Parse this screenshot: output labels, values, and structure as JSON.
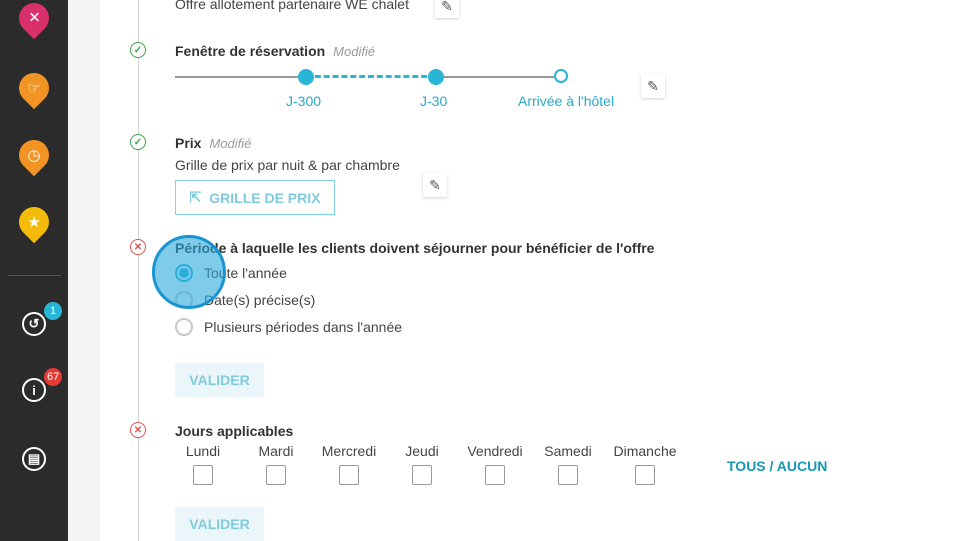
{
  "sidebar": {
    "icons": [
      "cutlery-icon",
      "hand-icon",
      "clock-icon",
      "star-icon"
    ],
    "colors": {
      "pink": "#d9306b",
      "orange": "#f29424",
      "yellow": "#f5bb0b"
    },
    "history_badge": "1",
    "info_badge": "67"
  },
  "top_offer_text": "Offre allotement partenaire WE chalet",
  "booking_window": {
    "title": "Fenêtre de réservation",
    "modified": "Modifié",
    "labels": [
      "J-300",
      "J-30",
      "Arrivée à l'hôtel"
    ]
  },
  "price": {
    "title": "Prix",
    "modified": "Modifié",
    "description": "Grille de prix par nuit & par chambre",
    "button": "GRILLE DE PRIX"
  },
  "stay_period": {
    "title": "Période à laquelle les clients doivent séjourner pour bénéficier de l'offre",
    "options": [
      "Toute l'année",
      "Date(s) précise(s)",
      "Plusieurs périodes dans l'année"
    ],
    "selected": "Toute l'année",
    "validate": "VALIDER"
  },
  "days": {
    "title": "Jours applicables",
    "list": [
      "Lundi",
      "Mardi",
      "Mercredi",
      "Jeudi",
      "Vendredi",
      "Samedi",
      "Dimanche"
    ],
    "all_none": "TOUS / AUCUN",
    "validate": "VALIDER"
  }
}
